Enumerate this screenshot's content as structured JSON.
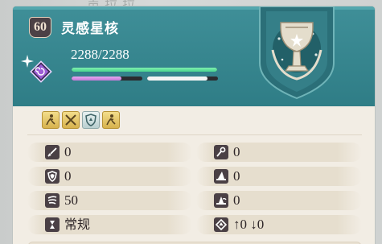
{
  "background": {
    "text": "声拉拉"
  },
  "item": {
    "level": "60",
    "name": "灵感星核",
    "hp_text": "2288/2288",
    "hp_fraction": 1.0,
    "mana_fraction": 0.7,
    "energy_fraction": 0.85
  },
  "skills": [
    {
      "icon": "sprint-figure-icon"
    },
    {
      "icon": "crossed-swords-icon"
    },
    {
      "icon": "shield-rune-icon"
    },
    {
      "icon": "sprint-figure-icon"
    }
  ],
  "stats": {
    "attack": "0",
    "defense": "0",
    "speed": "50",
    "type": "常规",
    "magic_attack": "0",
    "magic_defense": "0",
    "magic_speed": "0",
    "shift": "↑0 ↓0"
  },
  "colors": {
    "header": "#3a8890",
    "card": "#f2ede4",
    "hp_bar": "#57da95",
    "mana_bar": "#cf8ae0",
    "skill_gold": "#e3c463"
  }
}
